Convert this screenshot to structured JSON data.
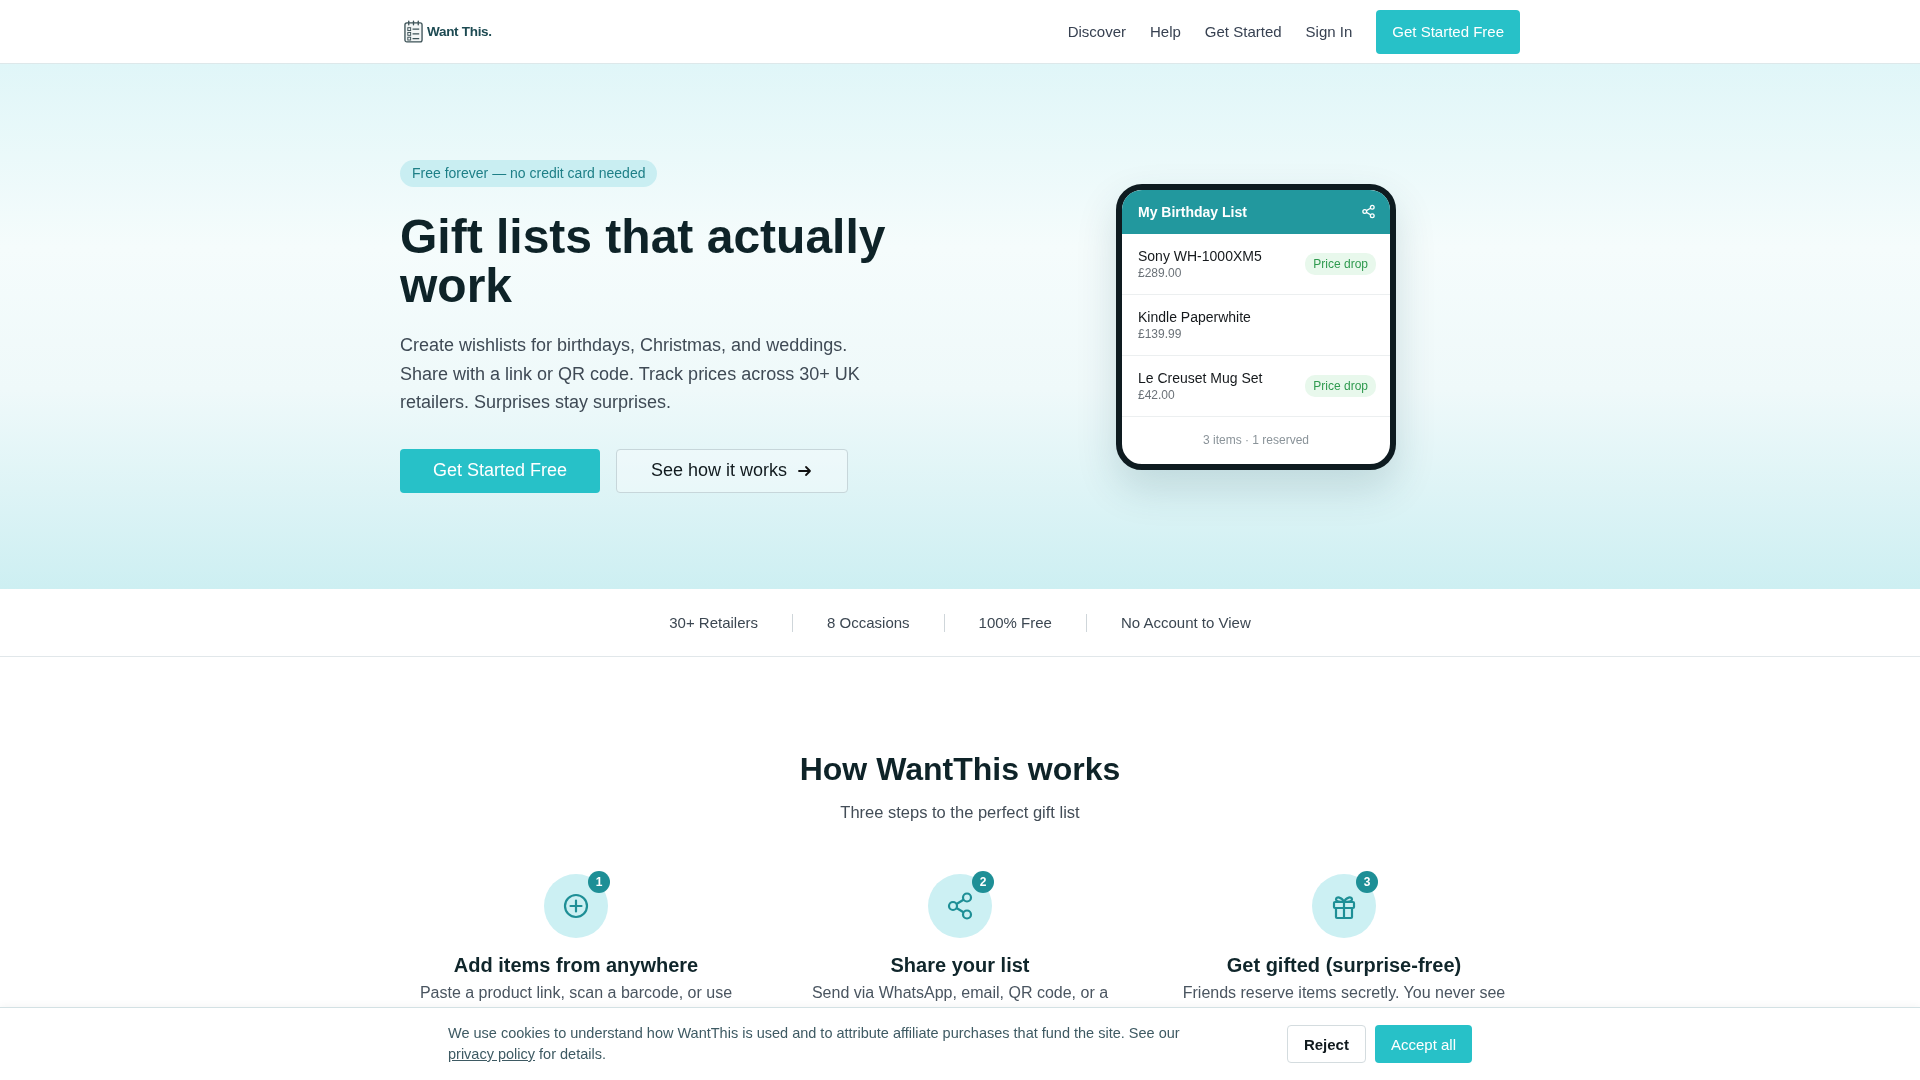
{
  "header": {
    "logo": "Want This.",
    "nav": [
      "Discover",
      "Help",
      "Get Started",
      "Sign In"
    ],
    "cta": "Get Started Free"
  },
  "hero": {
    "badge": "Free forever — no credit card needed",
    "title": "Gift lists that actually work",
    "description": "Create wishlists for birthdays, Christmas, and weddings. Share with a link or QR code. Track prices across 30+ UK retailers. Surprises stay surprises.",
    "buttons": [
      {
        "kind": "primary",
        "label": "Get Started Free"
      },
      {
        "kind": "secondary",
        "label": "See how it works"
      }
    ]
  },
  "preview": {
    "title": "My Birthday List",
    "items": [
      {
        "name": "Sony WH-1000XM5",
        "price": "£289.00",
        "badge": "Price drop"
      },
      {
        "name": "Kindle Paperwhite",
        "price": "£139.99"
      },
      {
        "name": "Le Creuset Mug Set",
        "price": "£42.00",
        "badge": "Price drop"
      }
    ],
    "footer": "3 items · 1 reserved"
  },
  "stats": [
    "30+ Retailers",
    "8 Occasions",
    "100% Free",
    "No Account to View"
  ],
  "how_it_works": {
    "title": "How WantThis works",
    "subtitle": "Three steps to the perfect gift list",
    "steps": [
      {
        "number": "1",
        "title": "Add items from anywhere",
        "description": "Paste a product link, scan a barcode, or use"
      },
      {
        "number": "2",
        "title": "Share your list",
        "description": "Send via WhatsApp, email, QR code, or a"
      },
      {
        "number": "3",
        "title": "Get gifted (surprise-free)",
        "description": "Friends reserve items secretly. You never see"
      }
    ]
  },
  "cookie_banner": {
    "text_before": "We use cookies to understand how WantThis is used and to attribute affiliate purchases that fund the site. See our ",
    "link": "privacy policy",
    "text_after": " for details.",
    "buttons": [
      {
        "kind": "secondary",
        "label": "Reject"
      },
      {
        "kind": "primary",
        "label": "Accept all"
      }
    ]
  }
}
